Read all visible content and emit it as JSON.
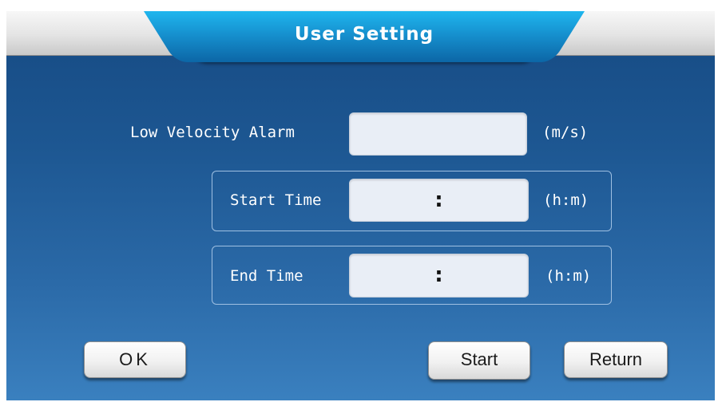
{
  "header": {
    "title": "User Setting"
  },
  "low_velocity_alarm": {
    "label": "Low Velocity Alarm",
    "value": "",
    "unit": "(m/s)"
  },
  "start_time": {
    "label": "Start Time",
    "value": ":",
    "unit": "(h:m)"
  },
  "end_time": {
    "label": "End Time",
    "value": ":",
    "unit": "(h:m)"
  },
  "buttons": {
    "ok": "OK",
    "start": "Start",
    "return": "Return"
  },
  "colors": {
    "panel_top": "#164a83",
    "panel_bottom": "#3a80bf",
    "title_tab": "#1691cf",
    "field_bg": "#e9eef6"
  }
}
